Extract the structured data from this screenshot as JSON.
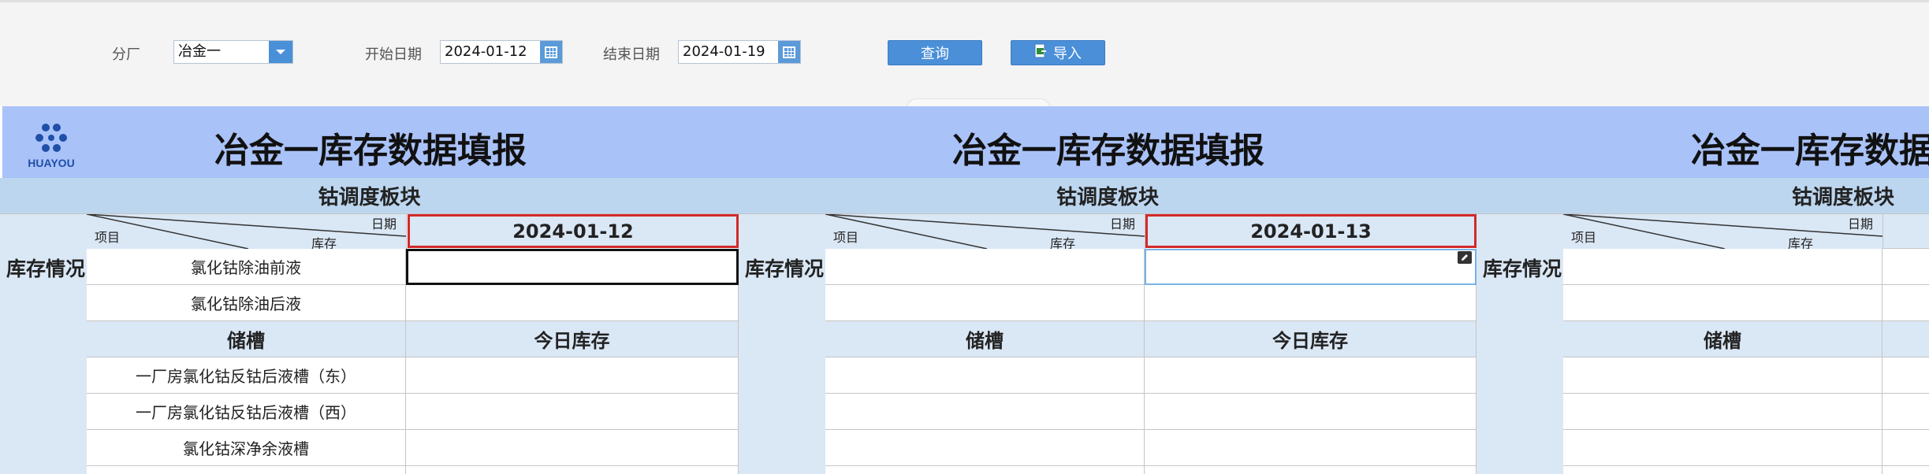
{
  "toolbar": {
    "branch_label": "分厂",
    "branch_value": "冶金一",
    "start_label": "开始日期",
    "start_value": "2024-01-12",
    "end_label": "结束日期",
    "end_value": "2024-01-19",
    "query_label": "查询",
    "import_label": "导入"
  },
  "logo_text": "HUAYOU",
  "report_title": "冶金一库存数据填报",
  "section_title": "钴调度板块",
  "diag": {
    "date": "日期",
    "item": "项目",
    "stock": "库存"
  },
  "side_label": "库存情况",
  "rows_top": [
    "氯化钴除油前液",
    "氯化钴除油后液"
  ],
  "tank_header": "储槽",
  "today_header": "今日库存",
  "rows_tank": [
    "一厂房氯化钴反钴后液槽（东）",
    "一厂房氯化钴反钴后液槽（西）",
    "氯化钴深净余液槽"
  ],
  "dates": [
    "2024-01-12",
    "2024-01-13"
  ],
  "colors": {
    "title_band": "#a9c2f8",
    "header": "#bdd6ef",
    "light": "#dae7f5",
    "button": "#4a8fd8",
    "date_border": "#d22a2a"
  }
}
